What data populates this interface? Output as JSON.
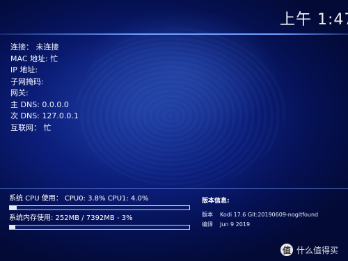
{
  "clock": "上午 1:47",
  "network": [
    {
      "label": "连接：",
      "value": "未连接"
    },
    {
      "label": "MAC 地址:",
      "value": "忙"
    },
    {
      "label": "IP 地址:",
      "value": ""
    },
    {
      "label": "子网掩码:",
      "value": ""
    },
    {
      "label": "网关:",
      "value": ""
    },
    {
      "label": "主 DNS:",
      "value": "0.0.0.0"
    },
    {
      "label": "次 DNS:",
      "value": "127.0.0.1"
    },
    {
      "label": "互联网：",
      "value": "忙"
    }
  ],
  "cpu": {
    "label": "系统 CPU 使用： CPU0: 3.8% CPU1: 4.0%",
    "percent": 4
  },
  "memory": {
    "label": "系统内存使用: 252MB / 7392MB - 3%",
    "percent": 3
  },
  "system": {
    "title": "版本信息:",
    "version_key": "版本",
    "version_value": "Kodi 17.6 Git:20190609-nogitfound",
    "build_key": "编译",
    "build_value": "Jun  9 2019"
  },
  "watermark": {
    "logo": "值",
    "text": "什么值得买"
  },
  "colors": {
    "background": "#0b1d78",
    "accent": "#6fa0ff"
  }
}
